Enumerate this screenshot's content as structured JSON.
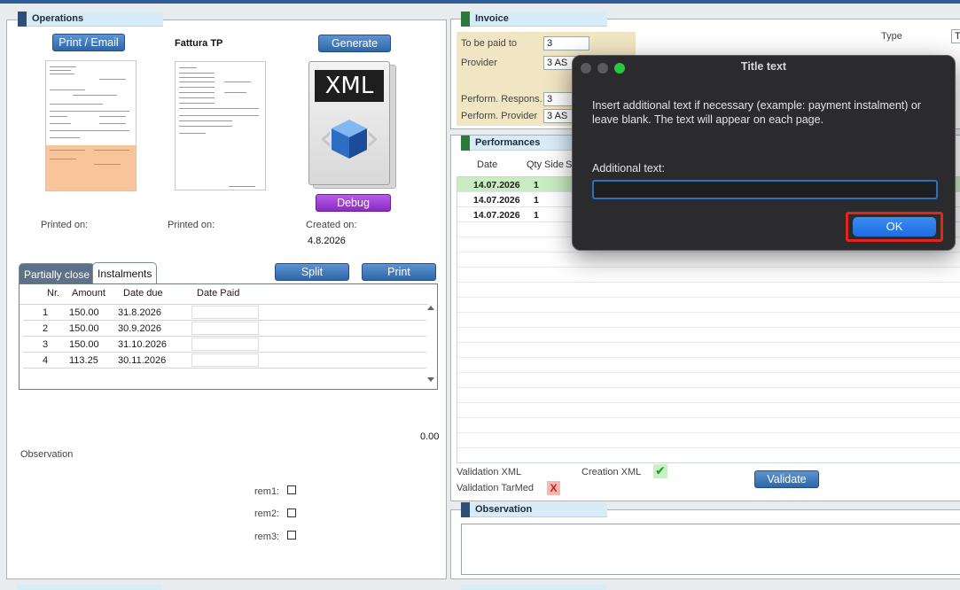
{
  "operations": {
    "title": "Operations",
    "print_email_label": "Print / Email",
    "fattura_label": "Fattura TP",
    "generate_label": "Generate",
    "xml_label": "XML",
    "debug_label": "Debug",
    "printed_on_1": "Printed on:",
    "printed_on_2": "Printed on:",
    "created_on_label": "Created on:",
    "created_on_value": "4.8.2026",
    "tabs": [
      "Partially close",
      "Instalments"
    ],
    "split_label": "Split",
    "print_label": "Print",
    "table": {
      "headers": [
        "Nr.",
        "Amount",
        "Date due",
        "Date Paid"
      ],
      "rows": [
        {
          "nr": "1",
          "amount": "150.00",
          "due": "31.8.2026"
        },
        {
          "nr": "2",
          "amount": "150.00",
          "due": "30.9.2026"
        },
        {
          "nr": "3",
          "amount": "150.00",
          "due": "31.10.2026"
        },
        {
          "nr": "4",
          "amount": "113.25",
          "due": "30.11.2026"
        }
      ]
    },
    "total": "0.00",
    "observation_label": "Observation",
    "rem": [
      "rem1:",
      "rem2:",
      "rem3:"
    ]
  },
  "invoice": {
    "title": "Invoice",
    "to_be_paid_label": "To be paid to",
    "to_be_paid_value": "3",
    "provider_label": "Provider",
    "provider_value": "3 AS",
    "perf_respons_label": "Perform. Respons.",
    "perf_respons_value": "3",
    "perf_provider_label": "Perform. Provider",
    "perf_provider_value": "3 AS",
    "type_label": "Type",
    "type_value": "Ta"
  },
  "performances": {
    "title": "Performances",
    "headers": [
      "Date",
      "Qty",
      "Side",
      "S"
    ],
    "rows": [
      {
        "date": "14.07.2026",
        "qty": "1"
      },
      {
        "date": "14.07.2026",
        "qty": "1"
      },
      {
        "date": "14.07.2026",
        "qty": "1"
      }
    ],
    "validation_xml_label": "Validation XML",
    "creation_xml_label": "Creation XML",
    "validation_tarmed_label": "Validation TarMed",
    "validate_label": "Validate",
    "check_glyph": "✔",
    "x_glyph": "X"
  },
  "observation": {
    "title": "Observation"
  },
  "dialog": {
    "title": "Title text",
    "message": "Insert additional text if necessary (example: payment instalment) or leave blank. The text will appear on each page.",
    "field_label": "Additional text:",
    "field_value": "",
    "ok_label": "OK"
  },
  "colors": {
    "accent_blue": "#2f66a8",
    "debug_purple": "#8a2bc4",
    "header_bg": "#d8ecf8",
    "ok_highlight": "#e0261b",
    "dialog_bg": "#2b2b2d"
  }
}
